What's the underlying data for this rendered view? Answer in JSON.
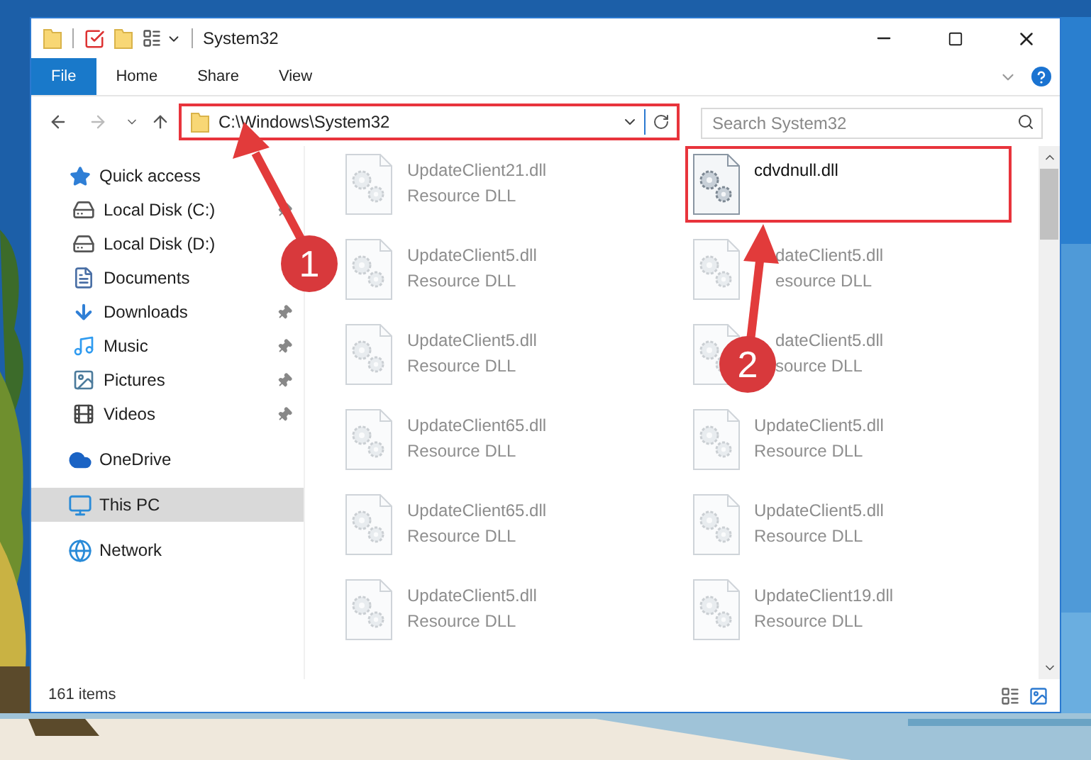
{
  "window": {
    "title": "System32"
  },
  "ribbon_tabs": [
    {
      "label": "File",
      "kind": "file",
      "selected": false
    },
    {
      "label": "Home",
      "kind": "tab",
      "selected": false
    },
    {
      "label": "Share",
      "kind": "tab",
      "selected": false
    },
    {
      "label": "View",
      "kind": "tab",
      "selected": false
    }
  ],
  "address_bar": {
    "path": "C:\\Windows\\System32",
    "highlighted": true
  },
  "search": {
    "placeholder": "Search System32"
  },
  "sidebar": {
    "items": [
      {
        "label": "Quick access",
        "selected": false,
        "children": [
          {
            "label": "Local Disk (C:)",
            "pinned": true,
            "selected": false
          },
          {
            "label": "Local Disk (D:)",
            "pinned": false,
            "selected": false
          },
          {
            "label": "Documents",
            "pinned": false,
            "selected": false
          },
          {
            "label": "Downloads",
            "pinned": true,
            "selected": false
          },
          {
            "label": "Music",
            "pinned": true,
            "selected": false
          },
          {
            "label": "Pictures",
            "pinned": true,
            "selected": false
          },
          {
            "label": "Videos",
            "pinned": true,
            "selected": false
          }
        ]
      },
      {
        "label": "OneDrive",
        "selected": false
      },
      {
        "label": "This PC",
        "selected": true
      },
      {
        "label": "Network",
        "selected": false
      }
    ]
  },
  "files": [
    {
      "name": "UpdateClient21.dll",
      "type": "Resource DLL",
      "faded": true,
      "highlighted": false,
      "covered": false
    },
    {
      "name": "cdvdnull.dll",
      "faded": false,
      "highlighted": true,
      "covered": false
    },
    {
      "name": "UpdateClient5.dll",
      "type": "Resource DLL",
      "faded": true,
      "highlighted": false,
      "covered": false
    },
    {
      "name": "dateClient5.dll",
      "type": "esource DLL",
      "faded": true,
      "highlighted": false,
      "covered": true
    },
    {
      "name": "UpdateClient5.dll",
      "type": "Resource DLL",
      "faded": true,
      "highlighted": false,
      "covered": false
    },
    {
      "name": "dateClient5.dll",
      "type": "source DLL",
      "faded": true,
      "highlighted": false,
      "covered": true
    },
    {
      "name": "UpdateClient65.dll",
      "type": "Resource DLL",
      "faded": true,
      "highlighted": false,
      "covered": false
    },
    {
      "name": "UpdateClient5.dll",
      "type": "Resource DLL",
      "faded": true,
      "highlighted": false,
      "covered": false
    },
    {
      "name": "UpdateClient65.dll",
      "type": "Resource DLL",
      "faded": true,
      "highlighted": false,
      "covered": false
    },
    {
      "name": "UpdateClient5.dll",
      "type": "Resource DLL",
      "faded": true,
      "highlighted": false,
      "covered": false
    },
    {
      "name": "UpdateClient5.dll",
      "type": "Resource DLL",
      "faded": true,
      "highlighted": false,
      "covered": false
    },
    {
      "name": "UpdateClient19.dll",
      "type": "Resource DLL",
      "faded": true,
      "highlighted": false,
      "covered": false
    }
  ],
  "status_bar": {
    "item_count": "161 items"
  },
  "callouts": [
    {
      "number": "1"
    },
    {
      "number": "2"
    }
  ]
}
